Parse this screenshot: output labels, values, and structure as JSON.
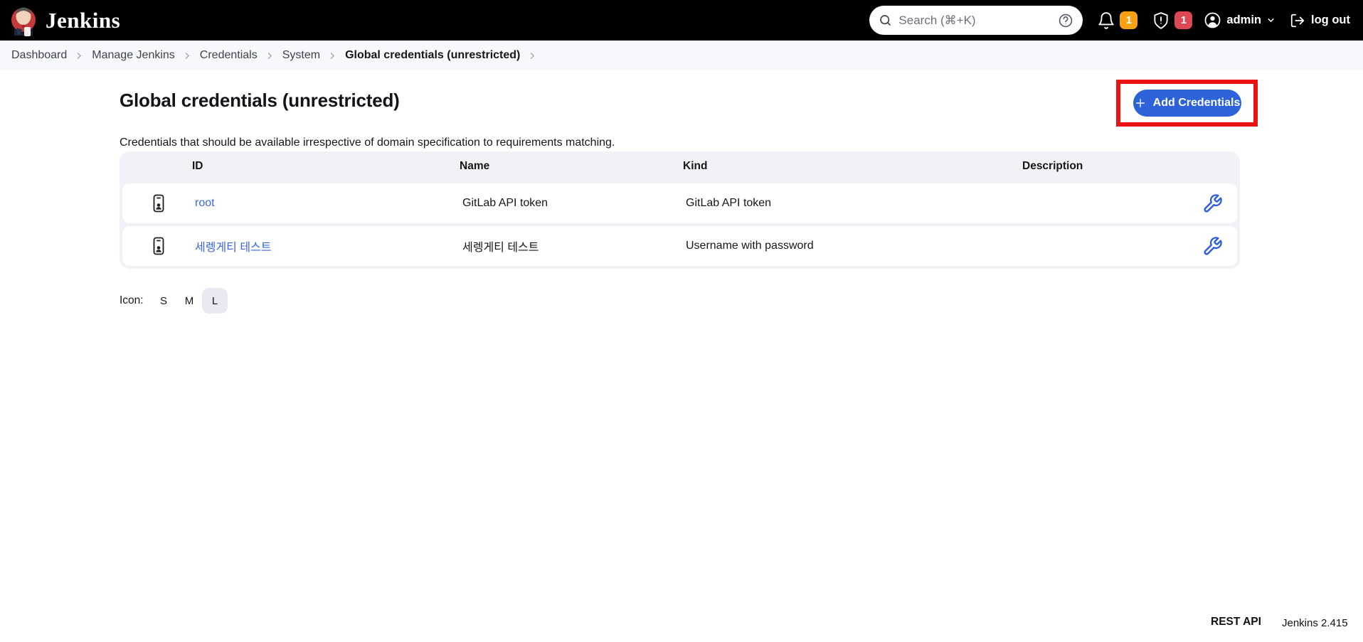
{
  "header": {
    "brand": "Jenkins",
    "search": {
      "placeholder": "Search (⌘+K)"
    },
    "notifications": {
      "badge": "1"
    },
    "security": {
      "badge": "1"
    },
    "user": {
      "name": "admin"
    },
    "logout": {
      "label": "log out"
    }
  },
  "breadcrumb": {
    "items": [
      "Dashboard",
      "Manage Jenkins",
      "Credentials",
      "System",
      "Global credentials (unrestricted)"
    ]
  },
  "page": {
    "title": "Global credentials (unrestricted)",
    "description": "Credentials that should be available irrespective of domain specification to requirements matching.",
    "add_credentials_label": "Add Credentials"
  },
  "table": {
    "columns": [
      "ID",
      "Name",
      "Kind",
      "Description"
    ],
    "rows": [
      {
        "id": "root",
        "name": "GitLab API token",
        "kind": "GitLab API token",
        "description": ""
      },
      {
        "id": "세렝게티 테스트",
        "name": "세렝게티 테스트",
        "kind": "Username with password",
        "description": ""
      }
    ]
  },
  "icon_size": {
    "label": "Icon:",
    "options": [
      "S",
      "M",
      "L"
    ],
    "selected": "L"
  },
  "footer": {
    "rest_api": "REST API",
    "version": "Jenkins 2.415"
  },
  "colors": {
    "accent_blue": "#2e62d9",
    "link_blue": "#3a66e3",
    "badge_orange": "#f9a115",
    "badge_red": "#dc4853",
    "annotation_red": "#e91313"
  }
}
